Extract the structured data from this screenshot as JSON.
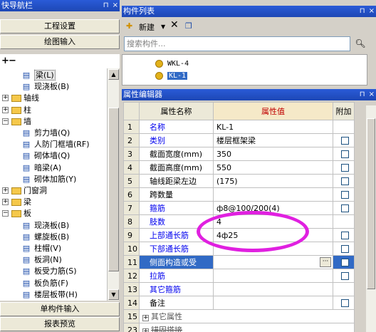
{
  "nav": {
    "title": "快导航栏",
    "pin": "⊓",
    "close": "×",
    "project_settings": "工程设置",
    "drawing_input": "绘图输入",
    "single_input": "单构件输入",
    "report_preview": "报表预览",
    "tree": [
      {
        "label": "梁(L)",
        "level": 2,
        "icon": "beam-icon",
        "selected": true
      },
      {
        "label": "现浇板(B)",
        "level": 2,
        "icon": "cast-slab-icon"
      },
      {
        "label": "轴线",
        "level": 0,
        "folder": true
      },
      {
        "label": "柱",
        "level": 0,
        "folder": true
      },
      {
        "label": "墙",
        "level": 0,
        "folder": true,
        "expanded": true
      },
      {
        "label": "剪力墙(Q)",
        "level": 2,
        "icon": "shear-wall-icon"
      },
      {
        "label": "人防门框墙(RF)",
        "level": 2,
        "icon": "civil-defense-door-icon"
      },
      {
        "label": "砌体墙(Q)",
        "level": 2,
        "icon": "masonry-wall-icon"
      },
      {
        "label": "暗梁(A)",
        "level": 2,
        "icon": "hidden-beam-icon"
      },
      {
        "label": "砌体加筋(Y)",
        "level": 2,
        "icon": "masonry-rebar-icon"
      },
      {
        "label": "门窗洞",
        "level": 0,
        "folder": true
      },
      {
        "label": "梁",
        "level": 0,
        "folder": true
      },
      {
        "label": "板",
        "level": 0,
        "folder": true,
        "expanded": true
      },
      {
        "label": "现浇板(B)",
        "level": 2,
        "icon": "cast-slab-icon"
      },
      {
        "label": "螺旋板(B)",
        "level": 2,
        "icon": "spiral-slab-icon"
      },
      {
        "label": "柱帽(V)",
        "level": 2,
        "icon": "column-cap-icon"
      },
      {
        "label": "板洞(N)",
        "level": 2,
        "icon": "slab-hole-icon"
      },
      {
        "label": "板受力筋(S)",
        "level": 2,
        "icon": "slab-stress-rebar-icon"
      },
      {
        "label": "板负筋(F)",
        "level": 2,
        "icon": "slab-neg-rebar-icon"
      },
      {
        "label": "楼层板带(H)",
        "level": 2,
        "icon": "floor-strip-icon"
      }
    ]
  },
  "complist": {
    "title": "构件列表",
    "new_label": "新建",
    "search_placeholder": "搜索构件...",
    "items": [
      "WKL-4",
      "KL-1"
    ]
  },
  "props": {
    "title": "属性编辑器",
    "col_name": "属性名称",
    "col_value": "属性值",
    "col_extra": "附加",
    "rows": [
      {
        "n": "1",
        "name": "名称",
        "value": "KL-1",
        "blue": true,
        "chk": false
      },
      {
        "n": "2",
        "name": "类别",
        "value": "楼层框架梁",
        "blue": true,
        "chk": true
      },
      {
        "n": "3",
        "name": "截面宽度(mm)",
        "value": "350",
        "blue": false,
        "chk": true
      },
      {
        "n": "4",
        "name": "截面高度(mm)",
        "value": "550",
        "blue": false,
        "chk": true
      },
      {
        "n": "5",
        "name": "轴线距梁左边",
        "value": "(175)",
        "blue": false,
        "chk": true
      },
      {
        "n": "6",
        "name": "跨数量",
        "value": "",
        "blue": false,
        "chk": true
      },
      {
        "n": "7",
        "name": "箍筋",
        "value": "ф8@100/200(4)",
        "blue": true,
        "chk": true
      },
      {
        "n": "8",
        "name": "肢数",
        "value": "4",
        "blue": true,
        "chk": false
      },
      {
        "n": "9",
        "name": "上部通长筋",
        "value": "4ф25",
        "blue": true,
        "chk": true
      },
      {
        "n": "10",
        "name": "下部通长筋",
        "value": "",
        "blue": true,
        "chk": true
      },
      {
        "n": "11",
        "name": "侧面构造或受",
        "value": "",
        "blue": true,
        "chk": true,
        "highlight": true
      },
      {
        "n": "12",
        "name": "拉筋",
        "value": "",
        "blue": true,
        "chk": true
      },
      {
        "n": "13",
        "name": "其它箍筋",
        "value": "",
        "blue": true,
        "chk": false
      },
      {
        "n": "14",
        "name": "备注",
        "value": "",
        "blue": false,
        "chk": true
      },
      {
        "n": "15",
        "name": "其它属性",
        "value": "",
        "group": true
      },
      {
        "n": "23",
        "name": "锚固搭接",
        "value": "",
        "group": true,
        "clipped": true
      }
    ]
  }
}
